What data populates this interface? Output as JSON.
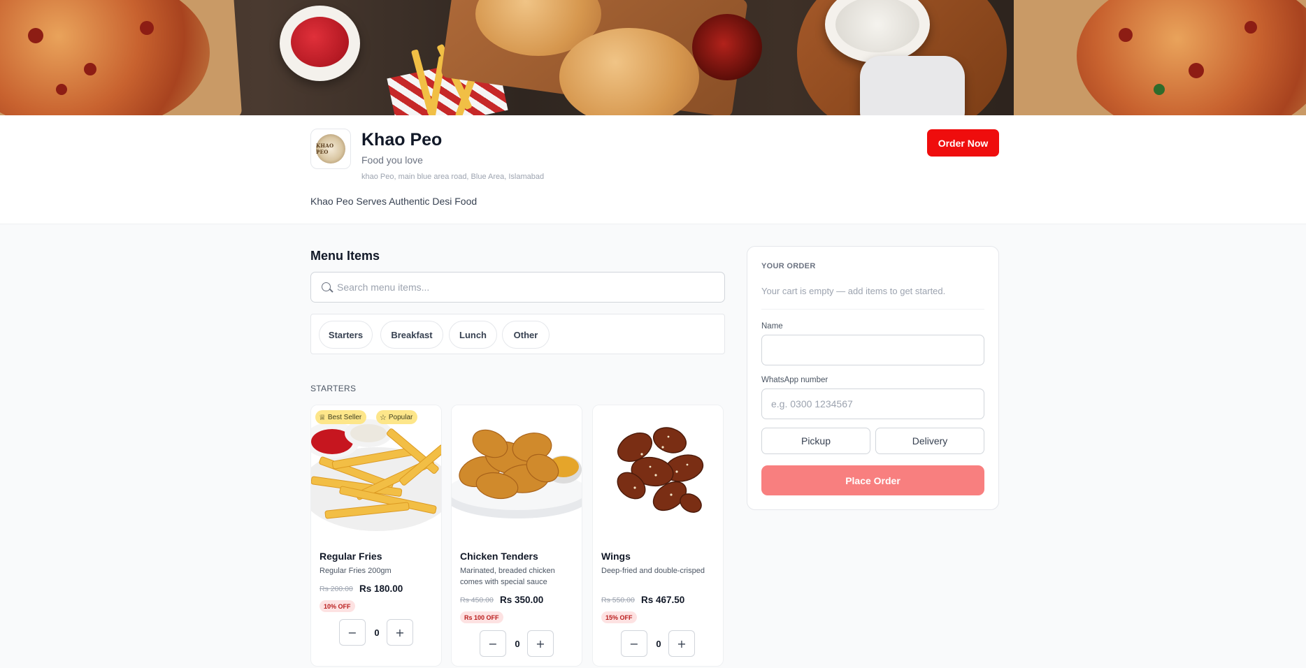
{
  "restaurant": {
    "name": "Khao Peo",
    "tagline": "Food you love",
    "address": "khao Peo, main blue area road, Blue Area, Islamabad",
    "description": "Khao Peo Serves Authentic Desi Food",
    "logo_text": "KHAO PEO",
    "order_now_label": "Order Now"
  },
  "menu": {
    "title": "Menu Items",
    "search_placeholder": "Search menu items...",
    "categories": [
      "Starters",
      "Breakfast",
      "Lunch",
      "Other"
    ],
    "section_label": "STARTERS",
    "items": [
      {
        "name": "Regular Fries",
        "description": "Regular Fries 200gm",
        "old_price": "Rs 200.00",
        "price": "Rs 180.00",
        "discount": "10% OFF",
        "quantity": "0",
        "badges": [
          "Best Seller",
          "Popular"
        ]
      },
      {
        "name": "Chicken Tenders",
        "description": "Marinated, breaded chicken comes with special sauce",
        "old_price": "Rs 450.00",
        "price": "Rs 350.00",
        "discount": "Rs 100 OFF",
        "quantity": "0"
      },
      {
        "name": "Wings",
        "description": "Deep-fried and double-crisped",
        "old_price": "Rs 550.00",
        "price": "Rs 467.50",
        "discount": "15% OFF",
        "quantity": "0"
      }
    ],
    "stepper": {
      "minus": "−",
      "plus": "+"
    }
  },
  "order": {
    "title": "YOUR ORDER",
    "empty_message": "Your cart is empty — add items to get started.",
    "name_label": "Name",
    "name_value": "",
    "whatsapp_label": "WhatsApp number",
    "whatsapp_placeholder": "e.g. 0300 1234567",
    "pickup_label": "Pickup",
    "delivery_label": "Delivery",
    "place_order_label": "Place Order"
  },
  "colors": {
    "accent": "#ef0d0d",
    "place_order_disabled": "#f87f7f",
    "badge": "#fde68a",
    "discount_bg": "#fde2e2"
  }
}
